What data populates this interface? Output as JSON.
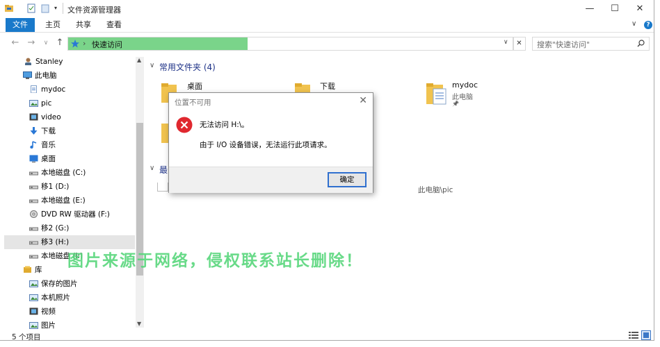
{
  "window": {
    "title": "文件资源管理器",
    "controls": {
      "minimize": "—",
      "maximize": "☐",
      "close": "✕"
    }
  },
  "ribbon": {
    "tabs": [
      {
        "label": "文件",
        "active": true
      },
      {
        "label": "主页"
      },
      {
        "label": "共享"
      },
      {
        "label": "查看"
      }
    ],
    "expand": "∨",
    "help": "?"
  },
  "nav": {
    "back": "←",
    "forward": "→",
    "recent": "∨",
    "up": "↑",
    "address_text": "快速访问",
    "address_sep": "›",
    "address_dropdown": "∨",
    "address_clear": "✕",
    "search_placeholder": "搜索\"快速访问\""
  },
  "sidebar": {
    "items": [
      {
        "label": "Stanley",
        "icon": "user-icon"
      },
      {
        "label": "此电脑",
        "icon": "computer-icon"
      },
      {
        "label": "mydoc",
        "icon": "document-icon"
      },
      {
        "label": "pic",
        "icon": "picture-icon"
      },
      {
        "label": "video",
        "icon": "video-icon"
      },
      {
        "label": "下载",
        "icon": "download-icon"
      },
      {
        "label": "音乐",
        "icon": "music-icon"
      },
      {
        "label": "桌面",
        "icon": "desktop-icon"
      },
      {
        "label": "本地磁盘 (C:)",
        "icon": "drive-icon"
      },
      {
        "label": "移1 (D:)",
        "icon": "drive-icon"
      },
      {
        "label": "本地磁盘 (E:)",
        "icon": "drive-icon"
      },
      {
        "label": "DVD RW 驱动器 (F:)",
        "icon": "dvd-icon"
      },
      {
        "label": "移2 (G:)",
        "icon": "drive-icon"
      },
      {
        "label": "移3 (H:)",
        "icon": "drive-icon",
        "selected": true
      },
      {
        "label": "本地磁盘 (I:)",
        "icon": "drive-icon"
      },
      {
        "label": "库",
        "icon": "library-icon"
      },
      {
        "label": "保存的图片",
        "icon": "picture-icon"
      },
      {
        "label": "本机照片",
        "icon": "picture-icon"
      },
      {
        "label": "视频",
        "icon": "video-icon"
      },
      {
        "label": "图片",
        "icon": "picture-icon"
      }
    ]
  },
  "main": {
    "frequent_header": "常用文件夹 (4)",
    "recent_header": "最",
    "folders": [
      {
        "name": "桌面"
      },
      {
        "name": "下载"
      },
      {
        "name": "mydoc",
        "sub": "此电脑",
        "pin": "📌"
      }
    ],
    "recent_path": "此电脑\\pic"
  },
  "status": {
    "count": "5 个项目"
  },
  "dialog": {
    "title": "位置不可用",
    "close": "✕",
    "message": "无法访问 H:\\。",
    "detail": "由于 I/O 设备错误，无法运行此项请求。",
    "ok": "确定"
  },
  "watermark": "图片来源于网络，侵权联系站长删除！",
  "colors": {
    "accent": "#1979ca",
    "address_highlight": "#7ad48a",
    "error": "#e0282f",
    "watermark": "#58d67c"
  }
}
